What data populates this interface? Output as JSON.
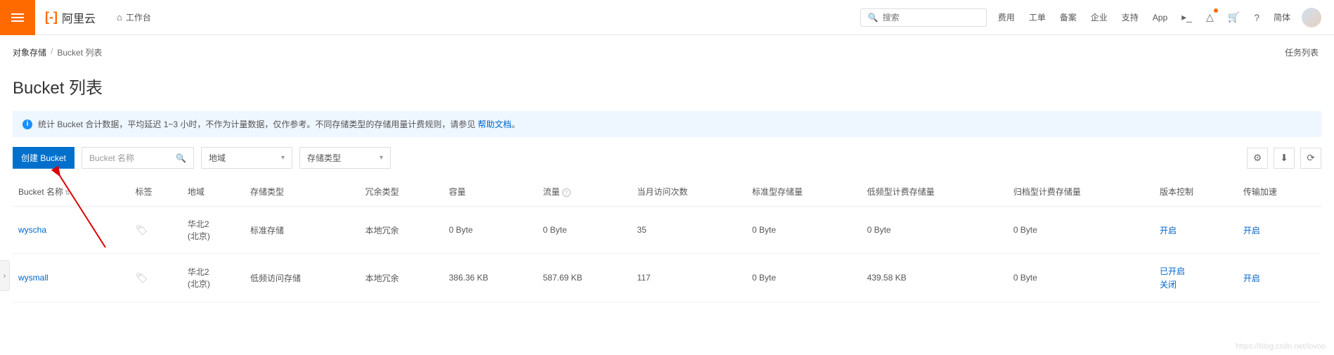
{
  "header": {
    "logo": "阿里云",
    "worktop": "工作台",
    "search_placeholder": "搜索",
    "nav": [
      "费用",
      "工单",
      "备案",
      "企业",
      "支持",
      "App"
    ],
    "lang": "简体"
  },
  "breadcrumb": {
    "parent": "对象存储",
    "current": "Bucket 列表",
    "right": "任务列表"
  },
  "page_title": "Bucket 列表",
  "banner": {
    "text": "统计 Bucket 合计数据，平均延迟 1~3 小时，不作为计量数据，仅作参考。不同存储类型的存储用量计费规则，请参见",
    "link": "帮助文档",
    "suffix": "。"
  },
  "toolbar": {
    "create_label": "创建 Bucket",
    "filter_placeholder": "Bucket 名称",
    "region_label": "地域",
    "storage_label": "存储类型"
  },
  "columns": {
    "name": "Bucket 名称",
    "tags": "标签",
    "region": "地域",
    "storage_type": "存储类型",
    "redundancy": "冗余类型",
    "capacity": "容量",
    "traffic": "流量",
    "visits": "当月访问次数",
    "std_store": "标准型存储量",
    "lowfreq_store": "低频型计费存储量",
    "archive_store": "归档型计费存储量",
    "version": "版本控制",
    "accel": "传输加速"
  },
  "rows": [
    {
      "name": "wyscha",
      "region_a": "华北2",
      "region_b": "(北京)",
      "storage_type": "标准存储",
      "redundancy": "本地冗余",
      "capacity": "0 Byte",
      "traffic": "0 Byte",
      "visits": "35",
      "std_store": "0 Byte",
      "lowfreq_store": "0 Byte",
      "archive_store": "0 Byte",
      "version_a": "开启",
      "version_b": "",
      "accel": "开启"
    },
    {
      "name": "wysmall",
      "region_a": "华北2",
      "region_b": "(北京)",
      "storage_type": "低频访问存储",
      "redundancy": "本地冗余",
      "capacity": "386.36 KB",
      "traffic": "587.69 KB",
      "visits": "117",
      "std_store": "0 Byte",
      "lowfreq_store": "439.58 KB",
      "archive_store": "0 Byte",
      "version_a": "已开启",
      "version_b": "关闭",
      "accel": "开启"
    }
  ],
  "watermark": "https://blog.csdn.net/lovoo"
}
